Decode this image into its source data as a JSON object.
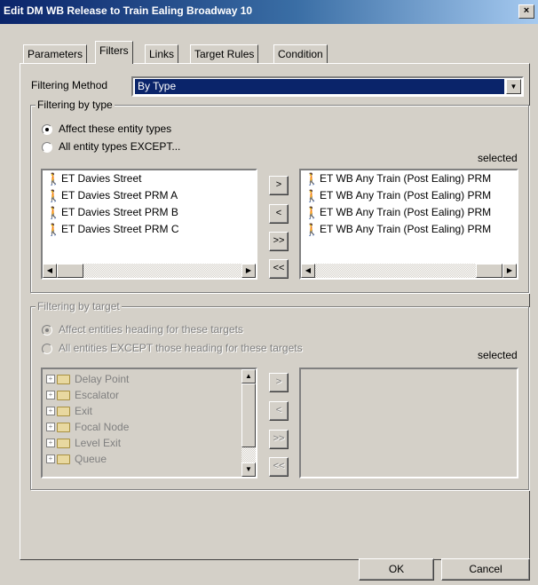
{
  "window": {
    "title": "Edit DM WB Release to Train Ealing Broadway 10",
    "close_glyph": "×"
  },
  "tabs": [
    {
      "label": "Parameters"
    },
    {
      "label": "Filters"
    },
    {
      "label": "Links"
    },
    {
      "label": "Target Rules"
    },
    {
      "label": "Condition"
    }
  ],
  "filtering_method": {
    "label": "Filtering Method",
    "value": "By Type"
  },
  "by_type": {
    "legend": "Filtering by type",
    "radio_affect": "Affect these entity types",
    "radio_except": "All entity types EXCEPT...",
    "selected_label": "selected",
    "available": [
      "ET Davies Street",
      "ET Davies Street PRM A",
      "ET Davies Street PRM B",
      "ET Davies Street PRM C"
    ],
    "selected": [
      "ET WB Any Train (Post Ealing) PRM",
      "ET WB Any Train (Post Ealing) PRM",
      "ET WB Any Train (Post Ealing) PRM",
      "ET WB Any Train (Post Ealing) PRM"
    ]
  },
  "by_target": {
    "legend": "Filtering by target",
    "radio_affect": "Affect entities heading for these targets",
    "radio_except": "All entities EXCEPT those heading for these targets",
    "selected_label": "selected",
    "tree": [
      "Delay Point",
      "Escalator",
      "Exit",
      "Focal Node",
      "Level Exit",
      "Queue"
    ]
  },
  "transfer_buttons": {
    "add": ">",
    "remove": "<",
    "add_all": ">>",
    "remove_all": "<<"
  },
  "footer": {
    "ok": "OK",
    "cancel": "Cancel"
  }
}
